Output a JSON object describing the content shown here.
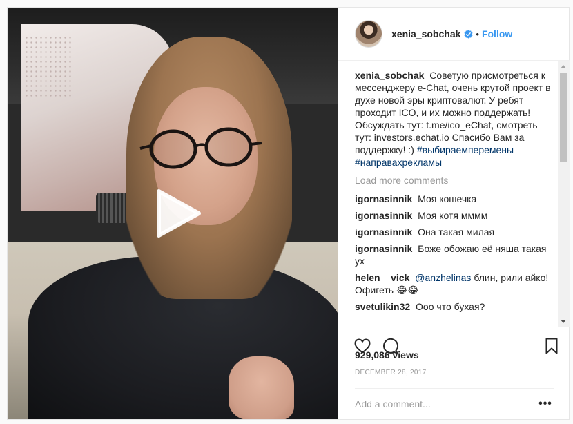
{
  "header": {
    "username": "xenia_sobchak",
    "separator": "•",
    "follow_label": "Follow"
  },
  "caption": {
    "username": "xenia_sobchak",
    "text": "Советую присмотреться к мессенджеру e-Chat, очень крутой проект в духе новой эры криптовалют. У ребят проходит ICO, и их можно поддержать! Обсуждать тут: t.me/ico_eChat, смотреть тут: investors.echat.io Спасибо Вам за поддержку! :)",
    "hashtag1": "#выбираемперемены",
    "hashtag2": "#направахрекламы"
  },
  "load_more": "Load more comments",
  "comments": [
    {
      "username": "igornasinnik",
      "text": "Моя кошечка"
    },
    {
      "username": "igornasinnik",
      "text": "Моя котя мммм"
    },
    {
      "username": "igornasinnik",
      "text": "Она такая милая"
    },
    {
      "username": "igornasinnik",
      "text": "Боже обожаю её няша такая ух"
    },
    {
      "username": "helen__vick",
      "mention": "@anzhelinas",
      "text": "блин, рили айко! Офигеть 😂😂"
    },
    {
      "username": "svetulikin32",
      "text": "Ооо что бухая?"
    }
  ],
  "icons": {
    "like": "heart-icon",
    "comment": "comment-icon",
    "save": "bookmark-icon",
    "verified": "verified-badge-icon",
    "play": "play-icon",
    "more": "more-options-icon"
  },
  "colors": {
    "link": "#3897f0",
    "hashtag": "#003569",
    "muted": "#999999"
  },
  "views": "929,086 views",
  "date": "DECEMBER 28, 2017",
  "add_comment": {
    "placeholder": "Add a comment...",
    "more": "•••"
  }
}
